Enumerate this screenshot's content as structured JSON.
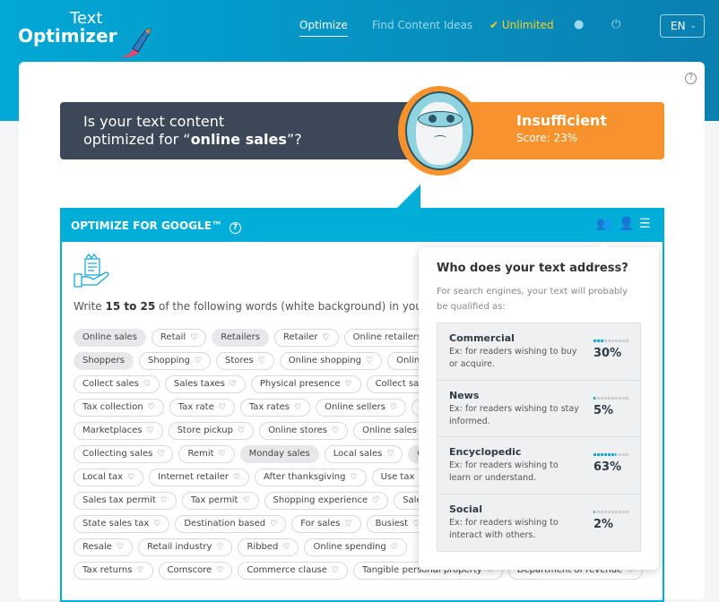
{
  "header": {
    "logo_line1": "Text",
    "logo_line2": "Optimizer",
    "nav": [
      "Optimize",
      "Find Content Ideas",
      "✔ Unlimited"
    ],
    "language": "EN",
    "icons": [
      "user-icon",
      "power-icon"
    ]
  },
  "hero": {
    "question_line1": "Is your text content",
    "question_prefix": "optimized for “",
    "keyword": "online sales",
    "question_suffix": "”?",
    "status": "Insufficient",
    "score_label": "Score: 23%",
    "score": 23,
    "status_color": "#f7922c"
  },
  "panel": {
    "title": "OPTIMIZE FOR GOOGLE™",
    "help": "?",
    "intro_prefix": "Write ",
    "intro_range": "15 to 25",
    "intro_suffix": " of the following words (white background) in your t",
    "rows": [
      [
        {
          "t": "Online sales",
          "hl": true
        },
        {
          "t": "Retail"
        },
        {
          "t": "Retailers",
          "hl": true
        },
        {
          "t": "Retailer"
        },
        {
          "t": "Online retailers"
        }
      ],
      [
        {
          "t": "Shoppers",
          "hl": true
        },
        {
          "t": "Shopping"
        },
        {
          "t": "Stores"
        },
        {
          "t": "Online shopping"
        },
        {
          "t": "Online"
        }
      ],
      [
        {
          "t": "Collect sales"
        },
        {
          "t": "Sales taxes"
        },
        {
          "t": "Physical presence"
        },
        {
          "t": "Collect sales t"
        }
      ],
      [
        {
          "t": "Tax collection"
        },
        {
          "t": "Tax rate"
        },
        {
          "t": "Tax rates"
        },
        {
          "t": "Online sellers"
        },
        {
          "t": "S"
        }
      ],
      [
        {
          "t": "Marketplaces"
        },
        {
          "t": "Store pickup"
        },
        {
          "t": "Online stores"
        },
        {
          "t": "Online sales ta"
        }
      ],
      [
        {
          "t": "Collecting sales"
        },
        {
          "t": "Remit"
        },
        {
          "t": "Monday sales",
          "hl": true
        },
        {
          "t": "Local sales"
        },
        {
          "t": "Cy",
          "hl": true
        }
      ],
      [
        {
          "t": "Local tax"
        },
        {
          "t": "Internet retailer"
        },
        {
          "t": "After thanksgiving"
        },
        {
          "t": "Use tax"
        }
      ],
      [
        {
          "t": "Sales tax permit"
        },
        {
          "t": "Tax permit"
        },
        {
          "t": "Shopping experience"
        },
        {
          "t": "Sales t"
        }
      ],
      [
        {
          "t": "State sales tax"
        },
        {
          "t": "Destination based"
        },
        {
          "t": "For sales"
        },
        {
          "t": "Busiest"
        }
      ],
      [
        {
          "t": "Resale"
        },
        {
          "t": "Retail industry"
        },
        {
          "t": "Ribbed"
        },
        {
          "t": "Online spending"
        }
      ],
      [
        {
          "t": "Tax returns"
        },
        {
          "t": "Comscore"
        },
        {
          "t": "Commerce clause"
        },
        {
          "t": "Tangible personal property"
        },
        {
          "t": "Department of revenue"
        }
      ]
    ]
  },
  "audience": {
    "title": "Who does your text address?",
    "subtitle": "For search engines, your text will probably be qualified as:",
    "categories": [
      {
        "name": "Commercial",
        "desc": "Ex: for readers wishing to buy or acquire.",
        "pct_label": "30%",
        "value": 30
      },
      {
        "name": "News",
        "desc": "Ex: for readers wishing to stay informed.",
        "pct_label": "5%",
        "value": 5
      },
      {
        "name": "Encyclopedic",
        "desc": "Ex: for readers wishing to learn or understand.",
        "pct_label": "63%",
        "value": 63
      },
      {
        "name": "Social",
        "desc": "Ex: for readers wishing to interact with others.",
        "pct_label": "2%",
        "value": 2
      }
    ]
  }
}
